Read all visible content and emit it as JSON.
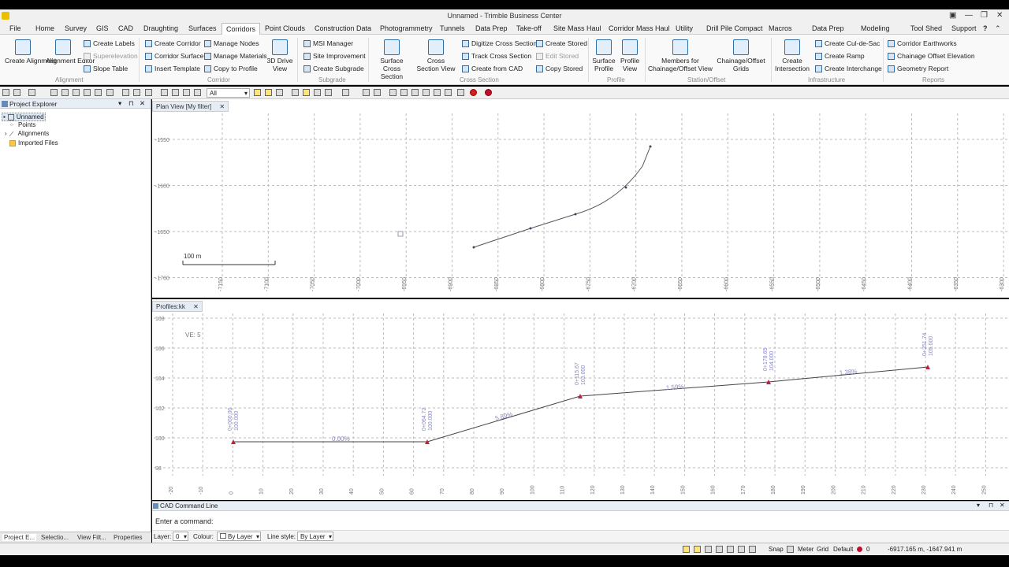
{
  "window": {
    "title": "Unnamed - Trimble Business Center"
  },
  "menu": [
    "File",
    "Home",
    "Survey",
    "GIS",
    "CAD",
    "Draughting",
    "Surfaces",
    "Corridors",
    "Point Clouds",
    "Construction Data",
    "Photogrammetry",
    "Tunnels",
    "Data Prep",
    "Take-off",
    "Site Mass Haul",
    "Corridor Mass Haul",
    "Utility",
    "Drill Pile Compact",
    "Macros",
    "Data Prep",
    "Modeling",
    "Tool Shed",
    "Support"
  ],
  "ribbon": {
    "create_alignment": "Create Alignment",
    "alignment_editor": "Alignment Editor",
    "create_labels": "Create Labels",
    "superelevation": "Superelevation",
    "slope_table": "Slope Table",
    "group_alignment": "Alignment",
    "create_corridor": "Create Corridor",
    "corridor_surface": "Corridor Surface",
    "insert_template": "Insert Template",
    "manage_nodes": "Manage Nodes",
    "manage_materials": "Manage Materials",
    "copy_to_profile": "Copy to Profile",
    "drive_view": "3D Drive View",
    "group_corridor": "Corridor",
    "msi_manager": "MSI Manager",
    "site_improvement": "Site Improvement",
    "create_subgrade": "Create Subgrade",
    "group_subgrade": "Subgrade",
    "surface_cross_section": "Surface Cross Section",
    "cross_section_view": "Cross Section View",
    "digitize_cross_section": "Digitize Cross Section",
    "track_cross_section": "Track Cross Section",
    "create_from_cad": "Create from CAD",
    "create_stored": "Create Stored",
    "edit_stored": "Edit Stored",
    "copy_stored": "Copy Stored",
    "group_cross_section": "Cross Section",
    "surface_profile": "Surface Profile",
    "profile_view": "Profile View",
    "group_profile": "Profile",
    "members_chainage": "Members for Chainage/Offset View",
    "chainage_offset_grids": "Chainage/Offset Grids",
    "group_station": "Station/Offset",
    "create_intersection": "Create Intersection",
    "create_culdesac": "Create Cul-de-Sac",
    "create_ramp": "Create Ramp",
    "create_interchange": "Create Interchange",
    "group_infrastructure": "Infrastructure",
    "corridor_earthworks": "Corridor Earthworks",
    "chainage_offset_elevation": "Chainage Offset Elevation",
    "geometry_report": "Geometry Report",
    "group_reports": "Reports"
  },
  "toolbar": {
    "filter": "All"
  },
  "explorer": {
    "title": "Project Explorer",
    "items": [
      "Unnamed",
      "Points",
      "Alignments",
      "Imported Files"
    ]
  },
  "sidebar_tabs": [
    "Project E...",
    "Selectio...",
    "View Filt...",
    "Properties"
  ],
  "plan": {
    "tab": "Plan View [My filter]",
    "scale": "100 m",
    "y_labels": [
      "-1550",
      "-1600",
      "-1650",
      "-1700"
    ],
    "x_labels": [
      "-7150",
      "-7100",
      "-7050",
      "-7000",
      "-6950",
      "-6900",
      "-6850",
      "-6800",
      "-6750",
      "-6700",
      "-6650",
      "-6600",
      "-6550",
      "-6500",
      "-6450",
      "-6400",
      "-6350",
      "-6300"
    ]
  },
  "profile": {
    "tab": "Profiles:kk",
    "ve": "VE: 5",
    "y_labels": [
      "108",
      "106",
      "104",
      "102",
      "100",
      "98"
    ],
    "x_labels": [
      "-20",
      "-10",
      "0",
      "10",
      "20",
      "30",
      "40",
      "50",
      "60",
      "70",
      "80",
      "90",
      "100",
      "110",
      "120",
      "130",
      "140",
      "150",
      "160",
      "170",
      "180",
      "190",
      "200",
      "210",
      "220",
      "230",
      "240",
      "250"
    ],
    "pvis": [
      {
        "ch": "0+000.00",
        "el": "100.000"
      },
      {
        "ch": "0+064.72",
        "el": "100.000"
      },
      {
        "ch": "0+115.67",
        "el": "103.000"
      },
      {
        "ch": "0+178.65",
        "el": "104.000"
      },
      {
        "ch": "0+251.74",
        "el": "105.000"
      }
    ],
    "grades": [
      "0.00%",
      "5.89%",
      "1.59%",
      "1.38%"
    ]
  },
  "cad": {
    "title": "CAD Command Line",
    "prompt": "Enter a command:",
    "layer_label": "Layer:",
    "layer": "0",
    "colour_label": "Colour:",
    "colour": "By Layer",
    "linestyle_label": "Line style:",
    "linestyle": "By Layer"
  },
  "status": {
    "snap": "Snap",
    "units": "Meter",
    "grid": "Grid",
    "mode": "Default",
    "count": "0",
    "coords": "-6917.165 m, -1647.941 m"
  }
}
